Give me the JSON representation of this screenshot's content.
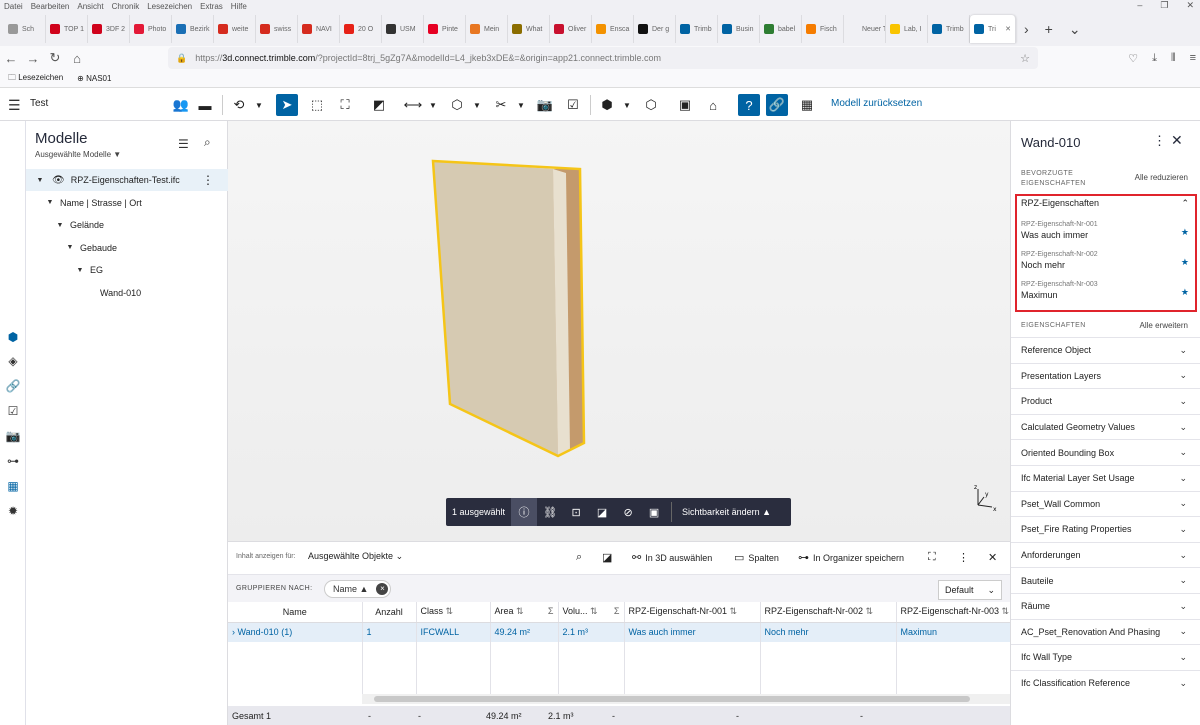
{
  "browser": {
    "menu": [
      "Datei",
      "Bearbeiten",
      "Ansicht",
      "Chronik",
      "Lesezeichen",
      "Extras",
      "Hilfe"
    ],
    "tabs": [
      {
        "label": "Sch",
        "color": "#999999"
      },
      {
        "label": "TOP 1",
        "color": "#d0021b"
      },
      {
        "label": "3DF 2",
        "color": "#d0021b"
      },
      {
        "label": "Photo",
        "color": "#e31937"
      },
      {
        "label": "Bezirk",
        "color": "#1a6fb5"
      },
      {
        "label": "weite",
        "color": "#d52b1e"
      },
      {
        "label": "swiss",
        "color": "#d52b1e"
      },
      {
        "label": "NAVI",
        "color": "#d52b1e"
      },
      {
        "label": "20 O",
        "color": "#e62117"
      },
      {
        "label": "USM",
        "color": "#333333"
      },
      {
        "label": "Pinte",
        "color": "#e60023"
      },
      {
        "label": "Mein",
        "color": "#e87722"
      },
      {
        "label": "What",
        "color": "#8b6d00"
      },
      {
        "label": "Oliver",
        "color": "#c8102e"
      },
      {
        "label": "Ensca",
        "color": "#f39200"
      },
      {
        "label": "Der g",
        "color": "#111111"
      },
      {
        "label": "Trimb",
        "color": "#0063a3"
      },
      {
        "label": "Busin",
        "color": "#0063a3"
      },
      {
        "label": "babel",
        "color": "#2e7d32"
      },
      {
        "label": "Fisch",
        "color": "#f57c00"
      },
      {
        "label": "Neuer Tab",
        "color": "#f0f0f4"
      },
      {
        "label": "Lab, I",
        "color": "#f9c400"
      },
      {
        "label": "Trimb",
        "color": "#0063a3"
      },
      {
        "label": "Tri",
        "color": "#0063a3"
      }
    ],
    "url_prefix": "https://",
    "url_host": "3d.connect.trimble.com",
    "url_path": "/?projectId=8trj_5gZg7A&modelId=L4_jkeb3xDE&=&origin=app21.connect.trimble.com",
    "bookmarks": [
      "Lesezeichen",
      "NAS01"
    ]
  },
  "app": {
    "project_name": "Test",
    "reset_label": "Modell zurücksetzen",
    "accent": "#0063a3"
  },
  "models": {
    "title": "Modelle",
    "subtitle": "Ausgewählte Modelle",
    "tree": [
      {
        "label": "RPZ-Eigenschaften-Test.ifc",
        "level": 0
      },
      {
        "label": "Name | Strasse | Ort",
        "level": 1
      },
      {
        "label": "Gelände",
        "level": 2
      },
      {
        "label": "Gebaude",
        "level": 3
      },
      {
        "label": "EG",
        "level": 4
      },
      {
        "label": "Wand-010",
        "level": 5
      }
    ]
  },
  "viewer": {
    "selected_count": "1 ausgewählt",
    "visibility_label": "Sichtbarkeit ändern",
    "highlight_color": "#f5c518",
    "axes": {
      "x": "x",
      "y": "y",
      "z": "z"
    }
  },
  "table": {
    "show_for_label": "Inhalt anzeigen für:",
    "show_for_value": "Ausgewählte Objekte",
    "select_3d": "In 3D auswählen",
    "columns_label": "Spalten",
    "save_organizer": "In Organizer speichern",
    "group_by_label": "GRUPPIEREN NACH:",
    "group_chip": "Name",
    "default_label": "Default",
    "headers": [
      "Name",
      "Anzahl",
      "Class",
      "Area",
      "Volu...",
      "RPZ-Eigenschaft-Nr-001",
      "RPZ-Eigenschaft-Nr-002",
      "RPZ-Eigenschaft-Nr-003"
    ],
    "rows": [
      [
        "Wand-010 (1)",
        "1",
        "IFCWALL",
        "49.24 m²",
        "2.1 m³",
        "Was auch immer",
        "Noch mehr",
        "Maximun"
      ]
    ],
    "footer": [
      "Gesamt 1",
      "-",
      "-",
      "49.24 m²",
      "2.1 m³",
      "-",
      "-",
      "-"
    ]
  },
  "properties": {
    "title": "Wand-010",
    "preferred_label": "BEVORZUGTE EIGENSCHAFTEN",
    "collapse_all": "Alle reduzieren",
    "group": "RPZ-Eigenschaften",
    "favorites": [
      {
        "name": "RPZ-Eigenschaft-Nr-001",
        "value": "Was auch immer"
      },
      {
        "name": "RPZ-Eigenschaft-Nr-002",
        "value": "Noch mehr"
      },
      {
        "name": "RPZ-Eigenschaft-Nr-003",
        "value": "Maximun"
      }
    ],
    "props_label": "EIGENSCHAFTEN",
    "expand_all": "Alle erweitern",
    "sections": [
      "Reference Object",
      "Presentation Layers",
      "Product",
      "Calculated Geometry Values",
      "Oriented Bounding Box",
      "Ifc Material Layer Set Usage",
      "Pset_Wall Common",
      "Pset_Fire Rating Properties",
      "Anforderungen",
      "Bauteile",
      "Räume",
      "AC_Pset_Renovation And Phasing",
      "Ifc Wall Type",
      "Ifc Classification Reference"
    ],
    "highlight_border": "#e0242c"
  }
}
